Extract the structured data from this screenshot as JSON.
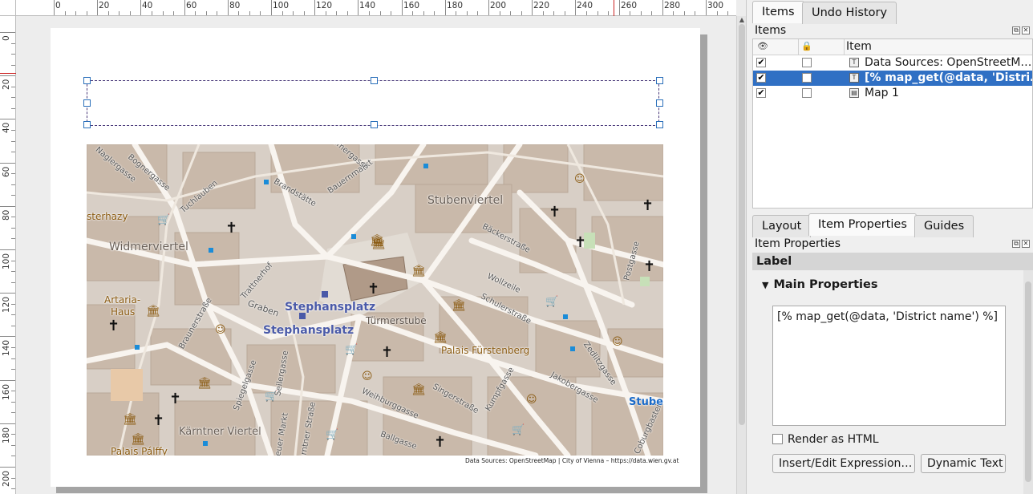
{
  "ruler": {
    "h_labels": [
      "0",
      "20",
      "40",
      "60",
      "80",
      "100",
      "120",
      "140",
      "160",
      "180",
      "200",
      "220",
      "240",
      "260",
      "280",
      "300"
    ],
    "v_labels": [
      "0",
      "20",
      "40",
      "60",
      "80",
      "100",
      "120",
      "140",
      "160",
      "180",
      "200"
    ]
  },
  "map": {
    "labels": [
      {
        "text": "Stubenviertel",
        "kind": "district"
      },
      {
        "text": "Widmerviertel",
        "kind": "district"
      },
      {
        "text": "Stephansplatz",
        "kind": "station"
      },
      {
        "text": "Stephansplatz",
        "kind": "station"
      },
      {
        "text": "Kärntner Viertel",
        "kind": "district"
      },
      {
        "text": "Palais Fürstenberg",
        "kind": "poi"
      },
      {
        "text": "Türmerstube",
        "kind": "poi"
      },
      {
        "text": "Artaria-",
        "kind": "poi"
      },
      {
        "text": "Haus",
        "kind": "poi"
      },
      {
        "text": "sterhazy",
        "kind": "poi"
      },
      {
        "text": "Palais Pálffy",
        "kind": "poi"
      },
      {
        "text": "Stuben",
        "kind": "station"
      },
      {
        "text": "Brandstätte",
        "kind": "street"
      },
      {
        "text": "Bauernmarkt",
        "kind": "street"
      },
      {
        "text": "Tuchlauben",
        "kind": "street"
      },
      {
        "text": "Bognergasse",
        "kind": "street"
      },
      {
        "text": "Naglergasse",
        "kind": "street"
      },
      {
        "text": "Bäckerstraße",
        "kind": "street"
      },
      {
        "text": "Wollzeile",
        "kind": "street"
      },
      {
        "text": "Schulerstraße",
        "kind": "street"
      },
      {
        "text": "Postgasse",
        "kind": "street"
      },
      {
        "text": "Zedlitzgasse",
        "kind": "street"
      },
      {
        "text": "Jakobergasse",
        "kind": "street"
      },
      {
        "text": "Singerstraße",
        "kind": "street"
      },
      {
        "text": "Kumpfgasse",
        "kind": "street"
      },
      {
        "text": "Weihburggasse",
        "kind": "street"
      },
      {
        "text": "Ballgasse",
        "kind": "street"
      },
      {
        "text": "Graben",
        "kind": "street"
      },
      {
        "text": "Trattnerhof",
        "kind": "street"
      },
      {
        "text": "Braunerstraße",
        "kind": "street"
      },
      {
        "text": "Spiegelgasse",
        "kind": "street"
      },
      {
        "text": "Seilergasse",
        "kind": "street"
      },
      {
        "text": "Neuer Markt",
        "kind": "street"
      },
      {
        "text": "Kärntner Straße",
        "kind": "street"
      },
      {
        "text": "Coburgbastei",
        "kind": "street"
      },
      {
        "text": "Kramergasse",
        "kind": "street"
      }
    ],
    "attribution": "Data Sources: OpenStreetMap | City of Vienna – https://data.wien.gv.at"
  },
  "items_panel": {
    "tabs": [
      "Items",
      "Undo History"
    ],
    "title": "Items",
    "column_item": "Item",
    "rows": [
      {
        "name": "Data Sources: OpenStreetM…",
        "visible": true,
        "locked": false,
        "type": "label",
        "selected": false
      },
      {
        "name": "[% map_get(@data, 'Distri…",
        "visible": true,
        "locked": false,
        "type": "label",
        "selected": true
      },
      {
        "name": "Map 1",
        "visible": true,
        "locked": false,
        "type": "map",
        "selected": false
      }
    ]
  },
  "props_panel": {
    "tabs": [
      "Layout",
      "Item Properties",
      "Guides"
    ],
    "title": "Item Properties",
    "section": "Label",
    "group": "Main Properties",
    "expression": "[% map_get(@data, 'District name') %]",
    "render_as_html_label": "Render as HTML",
    "render_as_html_checked": false,
    "insert_button": "Insert/Edit Expression…",
    "dynamic_button": "Dynamic Text"
  },
  "colors": {
    "selection": "#3070c4",
    "map_background": "#d8cfc6",
    "map_building": "#c8b8a8",
    "map_road": "#f7f3ee",
    "cursor_marker": "#cc2222"
  }
}
